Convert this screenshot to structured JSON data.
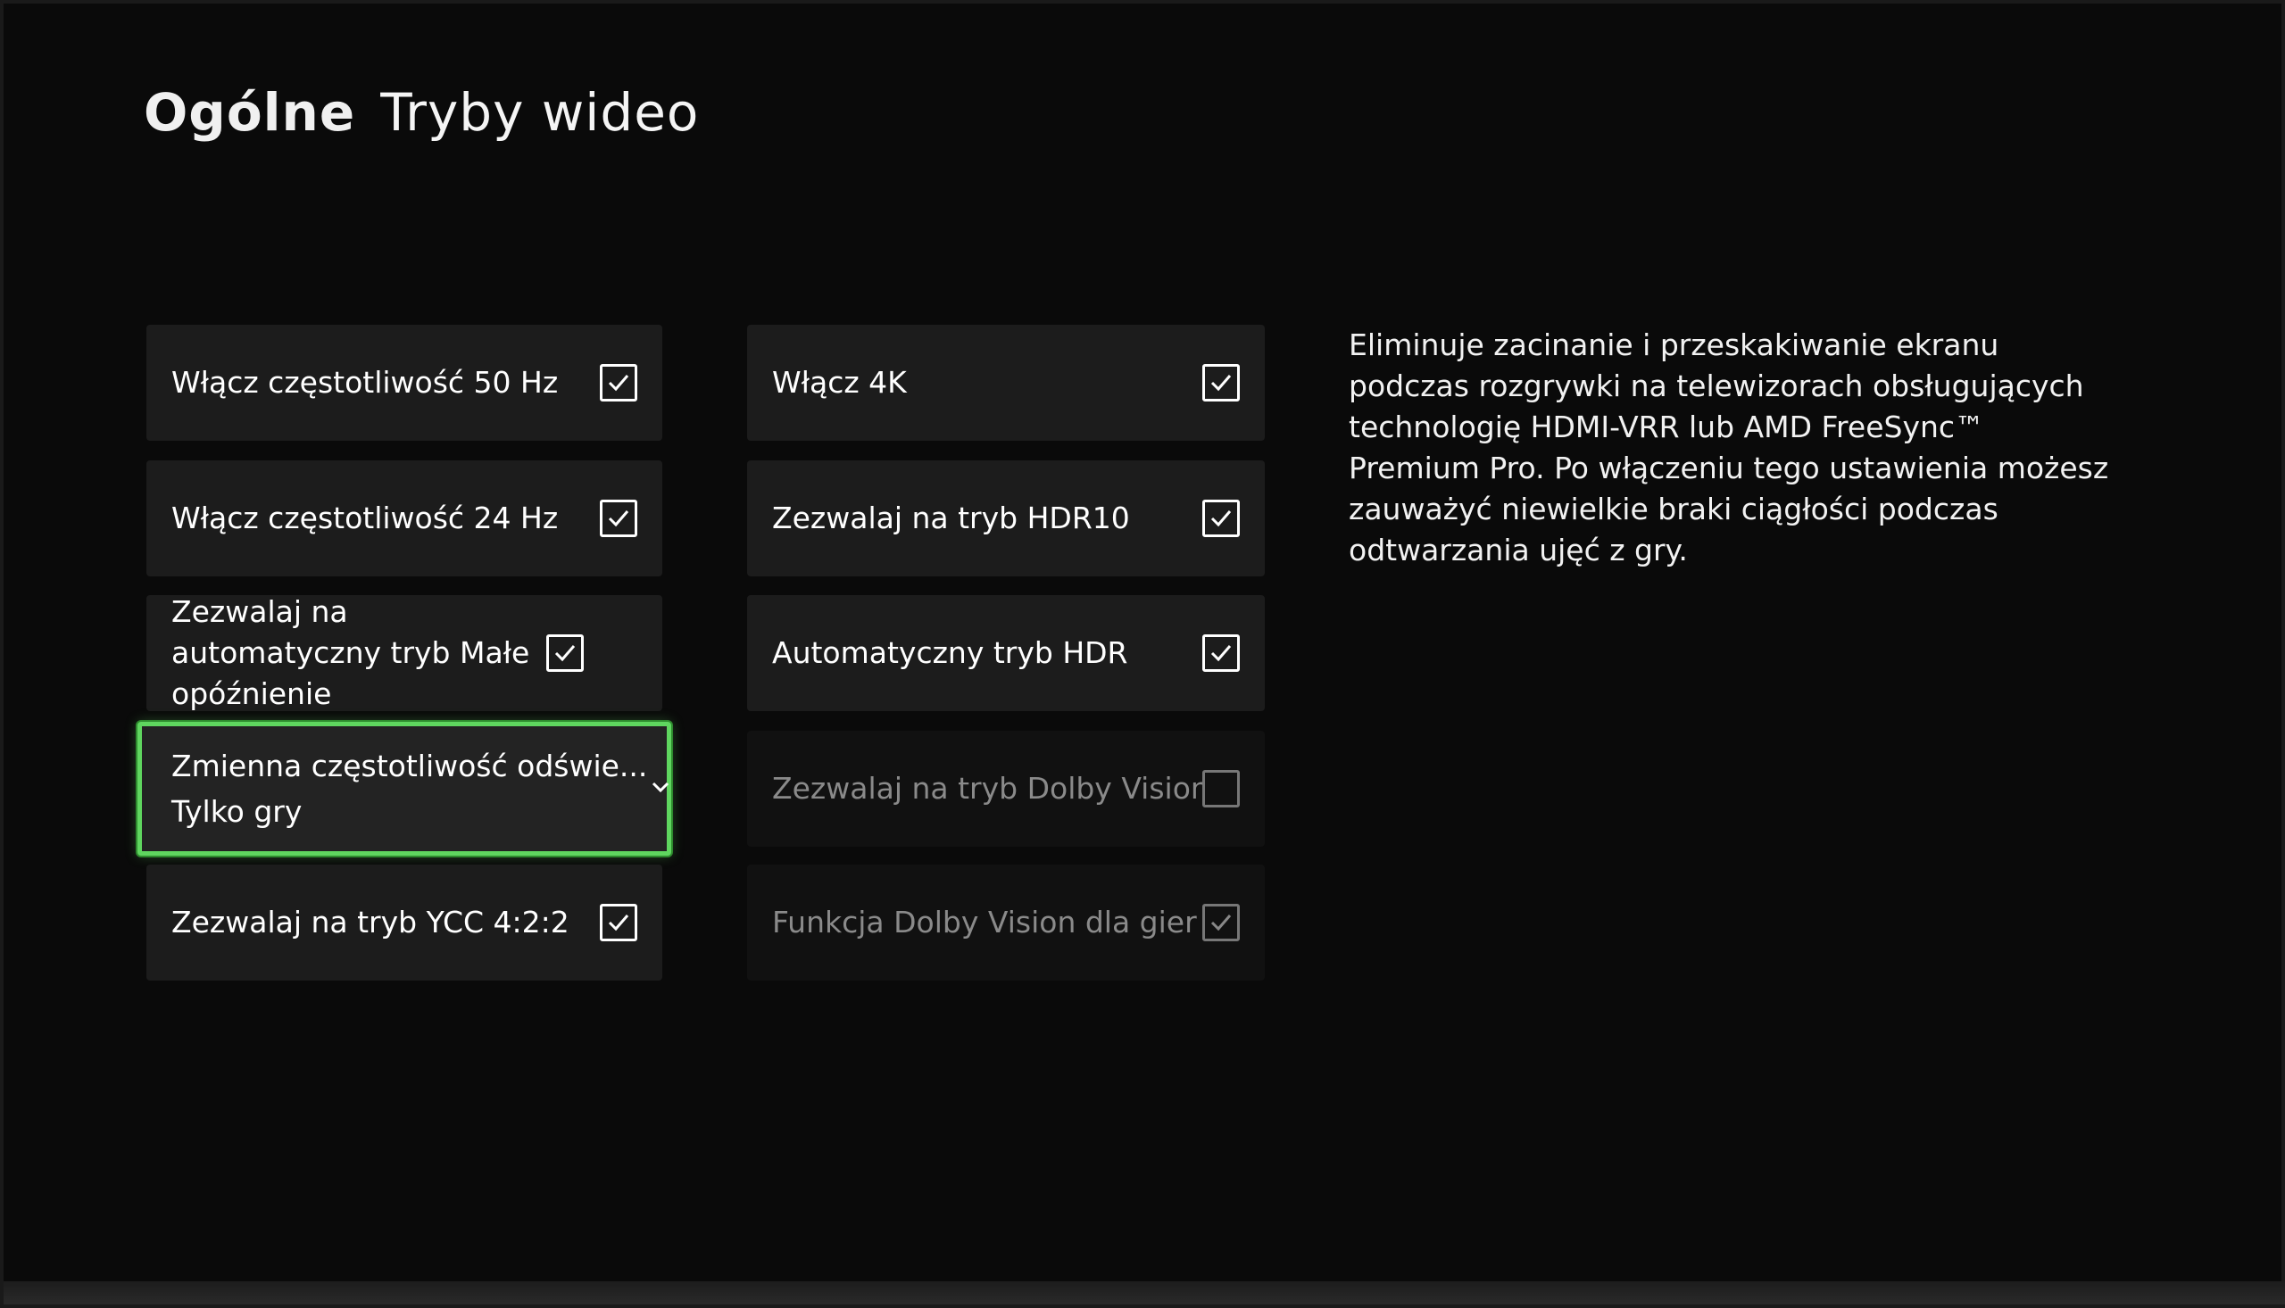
{
  "header": {
    "section": "Ogólne",
    "page": "Tryby wideo"
  },
  "column_left": [
    {
      "label": "Włącz częstotliwość 50 Hz",
      "checked": true
    },
    {
      "label": "Włącz częstotliwość 24 Hz",
      "checked": true
    },
    {
      "label": "Zezwalaj na automatyczny tryb Małe opóźnienie",
      "checked": true
    },
    {
      "label": "Zmienna częstotliwość odświe...",
      "value": "Tylko gry",
      "type": "dropdown",
      "focused": true
    },
    {
      "label": "Zezwalaj na tryb YCC 4:2:2",
      "checked": true
    }
  ],
  "column_right": [
    {
      "label": "Włącz 4K",
      "checked": true
    },
    {
      "label": "Zezwalaj na tryb HDR10",
      "checked": true
    },
    {
      "label": "Automatyczny tryb HDR",
      "checked": true
    },
    {
      "label": "Zezwalaj na tryb Dolby Vision",
      "checked": false,
      "disabled": true
    },
    {
      "label": "Funkcja Dolby Vision dla gier",
      "checked": true,
      "disabled": true
    }
  ],
  "description": "Eliminuje zacinanie i przeskakiwanie ekranu podczas rozgrywki na telewizorach obsługujących technologię HDMI-VRR lub AMD FreeSync™ Premium Pro. Po włączeniu tego ustawienia możesz zauważyć niewielkie braki ciągłości podczas odtwarzania ujęć z gry.",
  "icons": {
    "checkbox_checked": "checkmark-icon",
    "dropdown": "chevron-down-icon"
  },
  "colors": {
    "focus": "#5fd65f",
    "background": "#0a0a0a",
    "tile": "#1c1c1c"
  }
}
